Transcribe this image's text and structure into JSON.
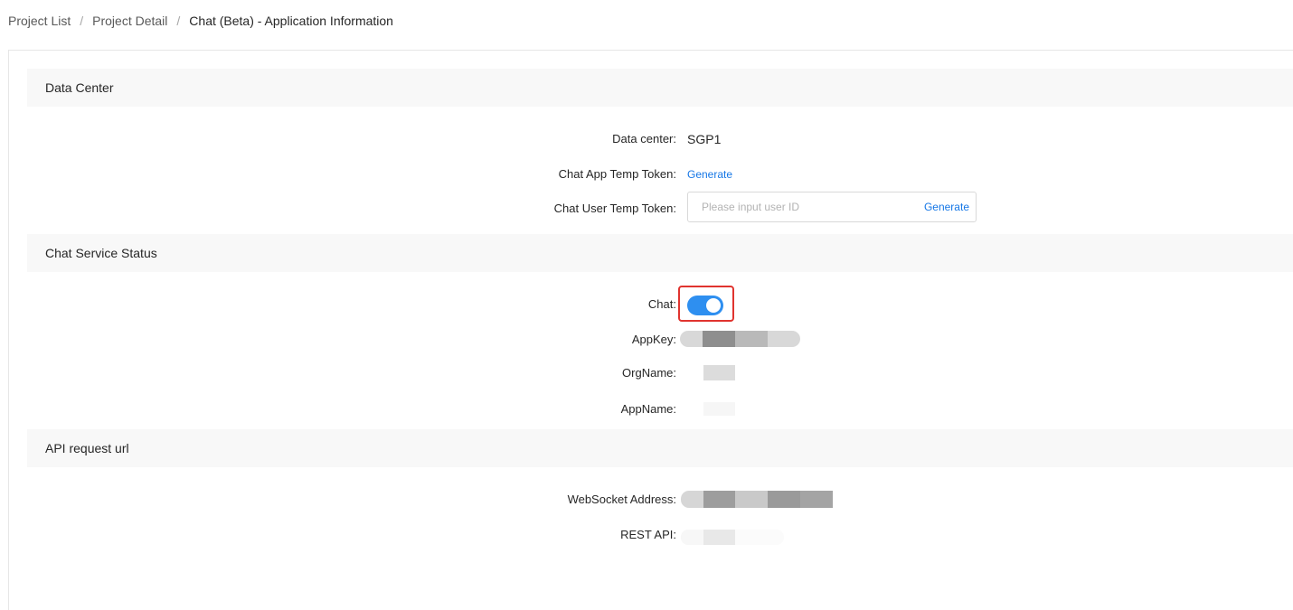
{
  "breadcrumb": {
    "project_list": "Project List",
    "separator": "/",
    "project_detail": "Project Detail",
    "current": "Chat (Beta) - Application Information"
  },
  "sections": {
    "data_center": "Data Center",
    "chat_service_status": "Chat Service Status",
    "api_request_url": "API request url"
  },
  "data_center": {
    "data_center_label": "Data center:",
    "data_center_value": "SGP1",
    "app_token_label": "Chat App Temp Token:",
    "app_token_action": "Generate",
    "user_token_label": "Chat User Temp Token:",
    "user_token_placeholder": "Please input user ID",
    "user_token_value": "",
    "user_token_action": "Generate"
  },
  "chat_service": {
    "chat_label": "Chat:",
    "chat_enabled": true,
    "appkey_label": "AppKey:",
    "orgname_label": "OrgName:",
    "appname_label": "AppName:"
  },
  "api": {
    "websocket_label": "WebSocket Address:",
    "rest_label": "REST API:"
  },
  "colors": {
    "accent": "#1677e6",
    "toggle_on": "#2e8ff0",
    "highlight": "#e0342f",
    "section_bg": "#f8f8f8"
  }
}
